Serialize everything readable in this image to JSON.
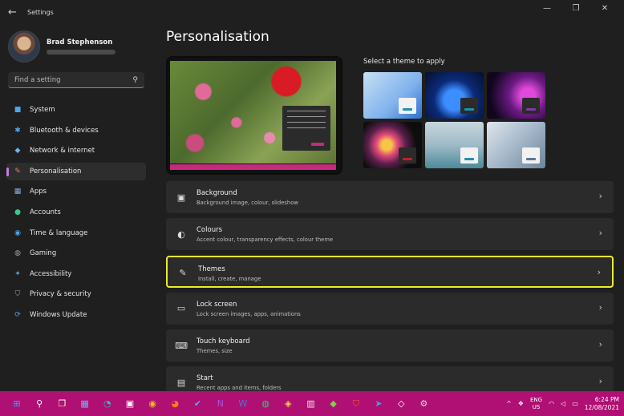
{
  "window": {
    "title": "Settings",
    "back_icon": "back-arrow-icon",
    "controls": [
      "—",
      "❐",
      "✕"
    ]
  },
  "profile": {
    "name": "Brad Stephenson"
  },
  "search": {
    "placeholder": "Find a setting"
  },
  "sidebar": {
    "items": [
      {
        "label": "System",
        "icon": "monitor-icon",
        "color": "#4aa8f0",
        "glyph": "■",
        "active": false
      },
      {
        "label": "Bluetooth & devices",
        "icon": "bluetooth-icon",
        "color": "#4aa8f0",
        "glyph": "✱",
        "active": false
      },
      {
        "label": "Network & internet",
        "icon": "wifi-icon",
        "color": "#66b8f2",
        "glyph": "◆",
        "active": false
      },
      {
        "label": "Personalisation",
        "icon": "brush-icon",
        "color": "#e28a4a",
        "glyph": "✎",
        "active": true
      },
      {
        "label": "Apps",
        "icon": "apps-icon",
        "color": "#7fb3e0",
        "glyph": "▦",
        "active": false
      },
      {
        "label": "Accounts",
        "icon": "account-icon",
        "color": "#3fc58b",
        "glyph": "●",
        "active": false
      },
      {
        "label": "Time & language",
        "icon": "globe-clock-icon",
        "color": "#4aa8f0",
        "glyph": "◉",
        "active": false
      },
      {
        "label": "Gaming",
        "icon": "gamepad-icon",
        "color": "#9aa0a6",
        "glyph": "◍",
        "active": false
      },
      {
        "label": "Accessibility",
        "icon": "accessibility-icon",
        "color": "#4aa8f0",
        "glyph": "✦",
        "active": false
      },
      {
        "label": "Privacy & security",
        "icon": "shield-icon",
        "color": "#9aa0a6",
        "glyph": "⛉",
        "active": false
      },
      {
        "label": "Windows Update",
        "icon": "update-icon",
        "color": "#4aa8f0",
        "glyph": "⟳",
        "active": false
      }
    ]
  },
  "main": {
    "title": "Personalisation",
    "theme_prompt": "Select a theme to apply",
    "themes": [
      {
        "name": "theme-windows-light",
        "accent": "#1d8fb0"
      },
      {
        "name": "theme-windows-dark",
        "accent": "#1d8fb0"
      },
      {
        "name": "theme-glow",
        "accent": "#7a3ea0"
      },
      {
        "name": "theme-captured-motion",
        "accent": "#c41e2a"
      },
      {
        "name": "theme-sunrise",
        "accent": "#1d8fb0"
      },
      {
        "name": "theme-flow",
        "accent": "#5a7a92"
      }
    ],
    "rows": [
      {
        "title": "Background",
        "subtitle": "Background image, colour, slideshow",
        "icon": "image-icon",
        "glyph": "▣",
        "highlight": false
      },
      {
        "title": "Colours",
        "subtitle": "Accent colour, transparency effects, colour theme",
        "icon": "palette-icon",
        "glyph": "◐",
        "highlight": false
      },
      {
        "title": "Themes",
        "subtitle": "Install, create, manage",
        "icon": "pen-icon",
        "glyph": "✎",
        "highlight": true
      },
      {
        "title": "Lock screen",
        "subtitle": "Lock screen images, apps, animations",
        "icon": "lock-screen-icon",
        "glyph": "▭",
        "highlight": false
      },
      {
        "title": "Touch keyboard",
        "subtitle": "Themes, size",
        "icon": "keyboard-icon",
        "glyph": "⌨",
        "highlight": false
      },
      {
        "title": "Start",
        "subtitle": "Recent apps and items, folders",
        "icon": "start-menu-icon",
        "glyph": "▤",
        "highlight": false
      }
    ]
  },
  "taskbar": {
    "icons": [
      {
        "name": "start-icon",
        "glyph": "⊞",
        "color": "#3aa0ff"
      },
      {
        "name": "search-icon",
        "glyph": "⚲",
        "color": "#ffffff"
      },
      {
        "name": "task-view-icon",
        "glyph": "❐",
        "color": "#ffffff"
      },
      {
        "name": "widgets-icon",
        "glyph": "▦",
        "color": "#5cc0ff"
      },
      {
        "name": "edge-icon",
        "glyph": "◔",
        "color": "#2ec4b6"
      },
      {
        "name": "store-icon",
        "glyph": "▣",
        "color": "#ffffff"
      },
      {
        "name": "chrome-icon",
        "glyph": "◉",
        "color": "#f4c20d"
      },
      {
        "name": "firefox-icon",
        "glyph": "◕",
        "color": "#ff7a1a"
      },
      {
        "name": "todo-icon",
        "glyph": "✔",
        "color": "#5aa8ff"
      },
      {
        "name": "onenote-icon",
        "glyph": "N",
        "color": "#a35ce0"
      },
      {
        "name": "word-icon",
        "glyph": "W",
        "color": "#3b7ddd"
      },
      {
        "name": "spotify-icon",
        "glyph": "◍",
        "color": "#1ed760"
      },
      {
        "name": "app-icon",
        "glyph": "◈",
        "color": "#ffd24a"
      },
      {
        "name": "notepad-icon",
        "glyph": "▥",
        "color": "#e8e8e8"
      },
      {
        "name": "app-icon-2",
        "glyph": "◆",
        "color": "#7bd14a"
      },
      {
        "name": "brave-icon",
        "glyph": "⛉",
        "color": "#ff5a1f"
      },
      {
        "name": "telegram-icon",
        "glyph": "➤",
        "color": "#35a8e0"
      },
      {
        "name": "app-icon-3",
        "glyph": "◇",
        "color": "#ffffff"
      },
      {
        "name": "settings-icon",
        "glyph": "⚙",
        "color": "#cfd8e0"
      }
    ],
    "tray": {
      "chevron": "^",
      "lang_line1": "ENG",
      "lang_line2": "US",
      "time": "6:24 PM",
      "date": "12/08/2021"
    }
  }
}
